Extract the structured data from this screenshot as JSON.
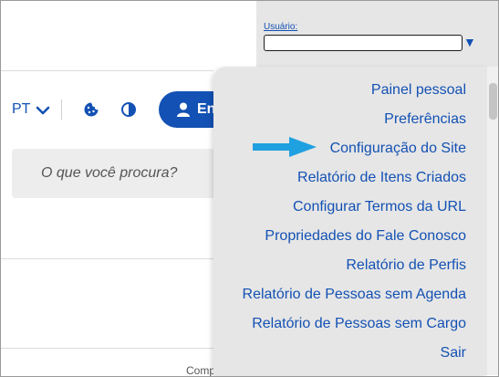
{
  "header": {
    "language": "PT",
    "enter_label": "En",
    "user_label": "Usuário:",
    "user_value": ""
  },
  "search": {
    "placeholder": "O que você procura?"
  },
  "footer": {
    "text": "Comp"
  },
  "menu": {
    "items": [
      {
        "label": "Painel pessoal"
      },
      {
        "label": "Preferências"
      },
      {
        "label": "Configuração do Site"
      },
      {
        "label": "Relatório de Itens Criados"
      },
      {
        "label": "Configurar Termos da URL"
      },
      {
        "label": "Propriedades do Fale Conosco"
      },
      {
        "label": "Relatório de Perfis"
      },
      {
        "label": "Relatório de Pessoas sem Agenda"
      },
      {
        "label": "Relatório de Pessoas sem Cargo"
      },
      {
        "label": "Sair"
      }
    ]
  },
  "colors": {
    "accent": "#1351b4",
    "pointer_arrow": "#1fa0e0",
    "menu_bg": "#e6e6e6"
  },
  "icons": {
    "language_chevron": "chevron-down-icon",
    "cookie": "cookie-icon",
    "contrast": "contrast-icon",
    "user": "user-icon",
    "user_dropdown": "triangle-down-icon",
    "pointer": "arrow-right-icon"
  }
}
